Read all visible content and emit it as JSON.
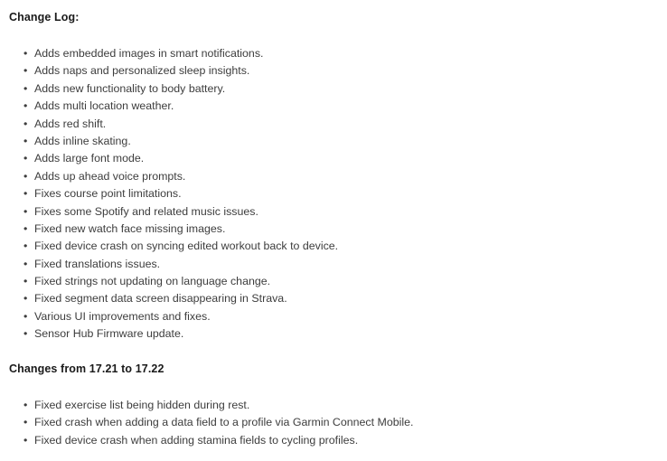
{
  "document": {
    "background_color": "#ffffff",
    "heading_color": "#1a1a1a",
    "body_text_color": "#3d3d3d",
    "bullet_glyph": "•"
  },
  "sections": [
    {
      "heading": "Change Log:",
      "items": [
        "Adds embedded images in smart notifications.",
        "Adds naps and personalized sleep insights.",
        "Adds new functionality to body battery.",
        "Adds multi location weather.",
        "Adds red shift.",
        "Adds inline skating.",
        "Adds large font mode.",
        "Adds up ahead voice prompts.",
        "Fixes course point limitations.",
        "Fixes some Spotify and related music issues.",
        "Fixed new watch face missing images.",
        "Fixed device crash on syncing edited workout back to device.",
        "Fixed translations issues.",
        "Fixed strings not updating on language change.",
        "Fixed segment data screen disappearing in Strava.",
        "Various UI improvements and fixes.",
        "Sensor Hub Firmware update."
      ]
    },
    {
      "heading": "Changes from 17.21 to 17.22",
      "items": [
        "Fixed exercise list being hidden during rest.",
        "Fixed crash when adding a data field to a profile via Garmin Connect Mobile.",
        "Fixed device crash when adding stamina fields to cycling profiles."
      ]
    }
  ]
}
